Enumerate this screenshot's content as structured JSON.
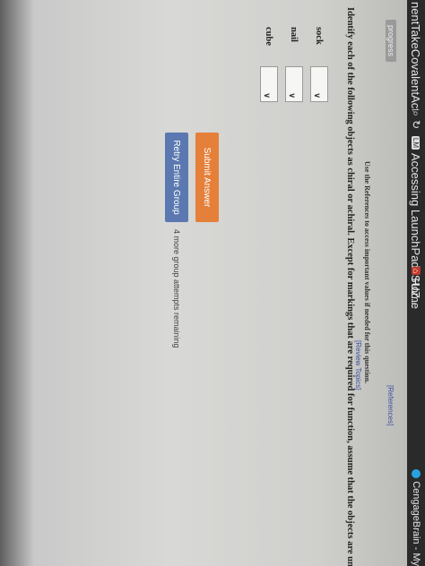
{
  "browser": {
    "address_text": "nentTakeCovalentActivity.",
    "search_icon": "search-icon",
    "reload_icon": "reload-icon",
    "tabs": [
      {
        "favicon": "LM",
        "label": "Accessing LaunchPad: SUZ..."
      },
      {
        "favicon": "home",
        "label": "Home"
      },
      {
        "favicon": "cengage",
        "label": "CengageBrain - My"
      }
    ]
  },
  "sidebar": {
    "progress_label": "progress"
  },
  "header": {
    "references_link": "[References]",
    "review_topics_link": "[Review Topics]",
    "notice": "Use the References to access important values if needed for this question."
  },
  "question": {
    "instructions": "Identify each of the following objects as chiral or achiral. Except for markings that are required for function, assume that the objects are unmarked.",
    "items": [
      {
        "label": "sock",
        "value": ""
      },
      {
        "label": "nail",
        "value": ""
      },
      {
        "label": "cube",
        "value": ""
      }
    ]
  },
  "actions": {
    "submit_label": "Submit Answer",
    "retry_label": "Retry Entire Group",
    "attempts_text": "4 more group attempts remaining"
  },
  "colors": {
    "submit": "#e5803a",
    "retry": "#5b79b0",
    "link": "#3b4fa0"
  }
}
